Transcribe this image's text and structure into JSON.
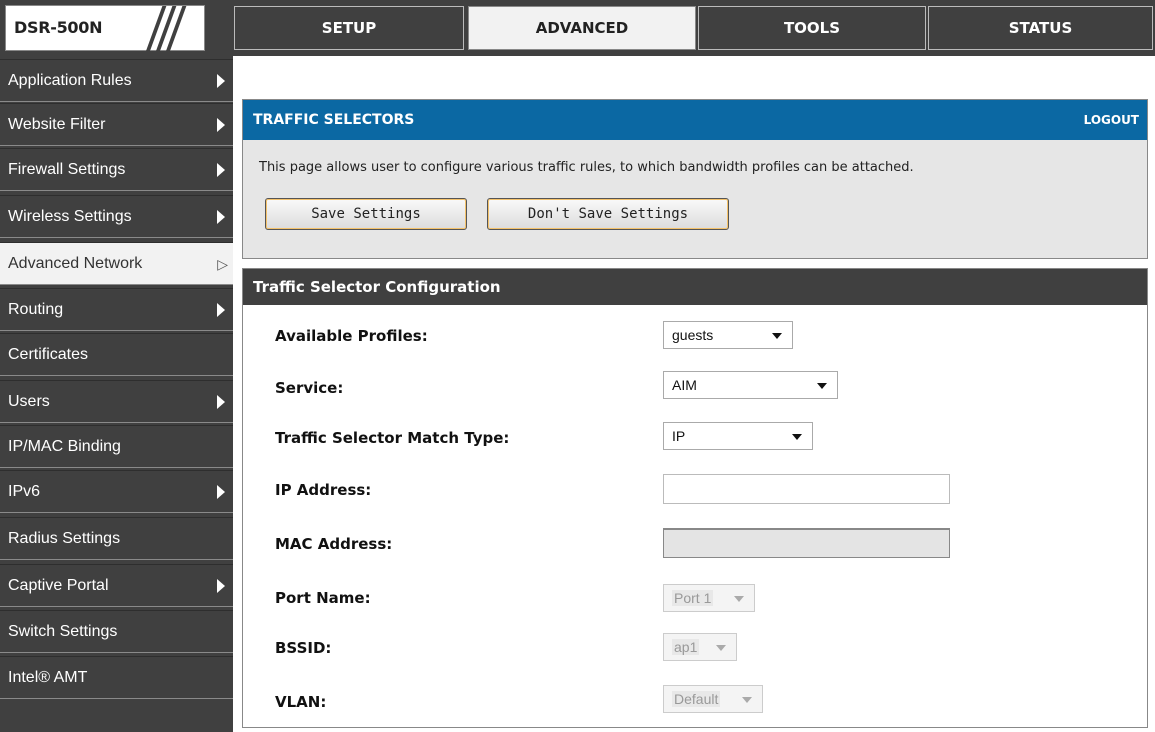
{
  "header": {
    "logo": "DSR-500N",
    "tabs": [
      {
        "label": "SETUP"
      },
      {
        "label": "ADVANCED"
      },
      {
        "label": "TOOLS"
      },
      {
        "label": "STATUS"
      }
    ]
  },
  "sidebar": {
    "items": [
      {
        "label": "Application Rules"
      },
      {
        "label": "Website Filter"
      },
      {
        "label": "Firewall Settings"
      },
      {
        "label": "Wireless Settings"
      },
      {
        "label": "Advanced Network"
      },
      {
        "label": "Routing"
      },
      {
        "label": "Certificates"
      },
      {
        "label": "Users"
      },
      {
        "label": "IP/MAC Binding"
      },
      {
        "label": "IPv6"
      },
      {
        "label": "Radius Settings"
      },
      {
        "label": "Captive Portal"
      },
      {
        "label": "Switch Settings"
      },
      {
        "label": "Intel® AMT"
      }
    ]
  },
  "selectors_panel": {
    "title": "TRAFFIC SELECTORS",
    "logout": "LOGOUT",
    "description": "This page allows user to configure various traffic rules, to which bandwidth profiles can be attached.",
    "save_label": "Save Settings",
    "dont_save_label": "Don't Save Settings"
  },
  "config": {
    "title": "Traffic Selector Configuration",
    "fields": {
      "profiles_label": "Available Profiles:",
      "profiles_value": "guests",
      "service_label": "Service:",
      "service_value": "AIM",
      "match_type_label": "Traffic Selector Match Type:",
      "match_type_value": "IP",
      "ip_label": "IP Address:",
      "ip_value": "",
      "mac_label": "MAC Address:",
      "mac_value": "",
      "port_label": "Port Name:",
      "port_value": "Port 1",
      "bssid_label": "BSSID:",
      "bssid_value": "ap1",
      "vlan_label": "VLAN:",
      "vlan_value": "Default"
    }
  },
  "colors": {
    "header_bg": "#404040",
    "panel_accent": "#0b68a3",
    "panel_body": "#e6e6e6"
  }
}
